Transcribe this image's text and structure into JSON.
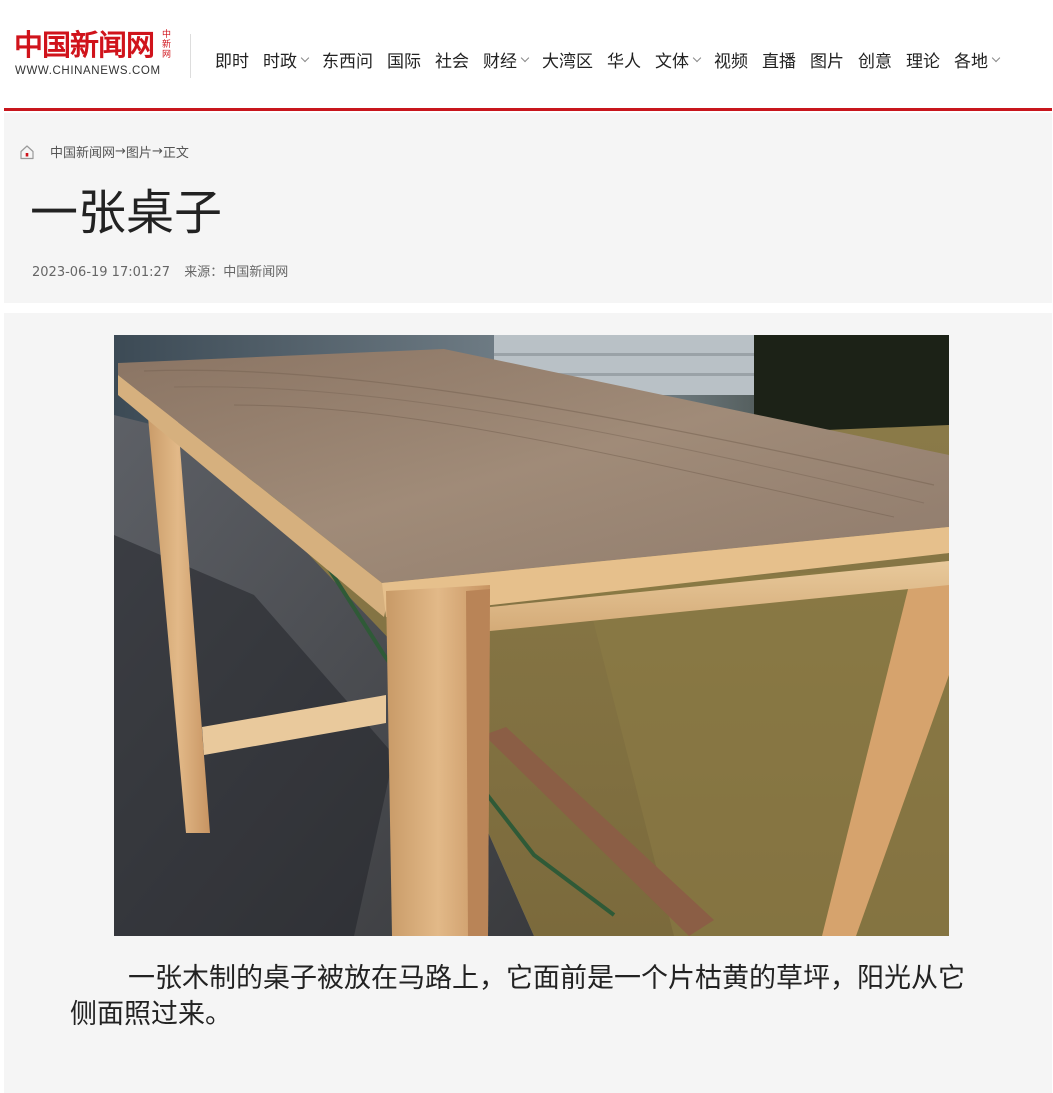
{
  "logo": {
    "cn": "中国新闻网",
    "side": "中新网",
    "en": "WWW.CHINANEWS.COM"
  },
  "nav": [
    {
      "label": "即时",
      "dropdown": false
    },
    {
      "label": "时政",
      "dropdown": true
    },
    {
      "label": "东西问",
      "dropdown": false
    },
    {
      "label": "国际",
      "dropdown": false
    },
    {
      "label": "社会",
      "dropdown": false
    },
    {
      "label": "财经",
      "dropdown": true
    },
    {
      "label": "大湾区",
      "dropdown": false
    },
    {
      "label": "华人",
      "dropdown": false
    },
    {
      "label": "文体",
      "dropdown": true
    },
    {
      "label": "视频",
      "dropdown": false
    },
    {
      "label": "直播",
      "dropdown": false
    },
    {
      "label": "图片",
      "dropdown": false
    },
    {
      "label": "创意",
      "dropdown": false
    },
    {
      "label": "理论",
      "dropdown": false
    },
    {
      "label": "各地",
      "dropdown": true
    }
  ],
  "breadcrumb": {
    "home": "中国新闻网",
    "sep1": " → ",
    "section": "图片",
    "sep2": "→",
    "current": "正文"
  },
  "article": {
    "title": "一张桌子",
    "datetime": "2023-06-19 17:01:27",
    "source": "来源：中国新闻网",
    "caption": "一张木制的桌子被放在马路上，它面前是一个片枯黄的草坪，阳光从它侧面照过来。"
  },
  "colors": {
    "brand_red": "#c8161d",
    "panel_bg": "#f5f5f5"
  }
}
